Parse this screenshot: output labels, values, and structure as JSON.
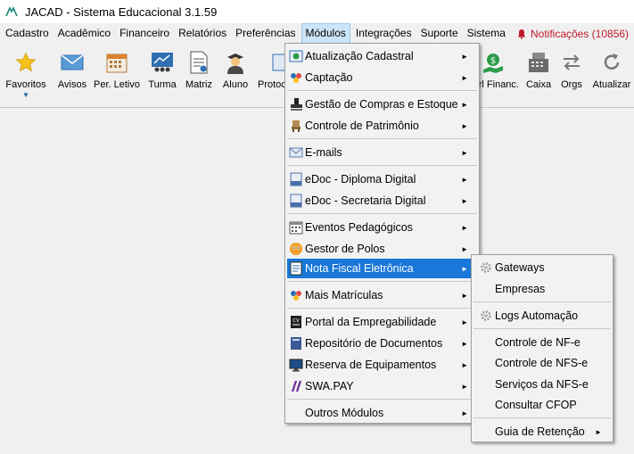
{
  "window": {
    "title": "JACAD - Sistema Educacional 3.1.59"
  },
  "menubar": {
    "items": [
      {
        "label": "Cadastro"
      },
      {
        "label": "Acadêmico"
      },
      {
        "label": "Financeiro"
      },
      {
        "label": "Relatórios"
      },
      {
        "label": "Preferências"
      },
      {
        "label": "Módulos"
      },
      {
        "label": "Integrações"
      },
      {
        "label": "Suporte"
      },
      {
        "label": "Sistema"
      }
    ],
    "notifications": "Notificações (10856)",
    "notification_color": "#c0182a"
  },
  "toolbar": {
    "items": [
      {
        "label": "Favoritos",
        "icon": "star-icon"
      },
      {
        "label": "Avisos",
        "icon": "envelope-icon"
      },
      {
        "label": "Per. Letivo",
        "icon": "calendar-icon"
      },
      {
        "label": "Turma",
        "icon": "class-icon"
      },
      {
        "label": "Matriz",
        "icon": "document-icon"
      },
      {
        "label": "Aluno",
        "icon": "student-icon"
      },
      {
        "label": "Protoc",
        "icon": "protocol-icon"
      },
      {
        "label": "rl Financ.",
        "icon": "money-icon"
      },
      {
        "label": "Caixa",
        "icon": "cash-register-icon"
      },
      {
        "label": "Orgs",
        "icon": "arrows-icon"
      },
      {
        "label": "Atualizar",
        "icon": "refresh-icon"
      }
    ]
  },
  "modulos_menu": {
    "items": [
      {
        "label": "Atualização Cadastral",
        "icon": "update-icon",
        "submenu": true
      },
      {
        "label": "Captação",
        "icon": "capture-icon",
        "submenu": true
      },
      {
        "label": "Gestão de Compras e Estoque",
        "icon": "stamp-icon",
        "submenu": true
      },
      {
        "label": "Controle de Patrimônio",
        "icon": "chair-icon",
        "submenu": true
      },
      {
        "label": "E-mails",
        "icon": "email-icon",
        "submenu": true
      },
      {
        "label": "eDoc - Diploma Digital",
        "icon": "edoc-icon",
        "submenu": true
      },
      {
        "label": "eDoc - Secretaria Digital",
        "icon": "edoc-icon",
        "submenu": true
      },
      {
        "label": "Eventos Pedagógicos",
        "icon": "events-icon",
        "submenu": true
      },
      {
        "label": "Gestor de Polos",
        "icon": "poles-icon",
        "submenu": true
      },
      {
        "label": "Nota Fiscal Eletrônica",
        "icon": "invoice-icon",
        "submenu": true
      },
      {
        "label": "Mais Matrículas",
        "icon": "enroll-icon",
        "submenu": true
      },
      {
        "label": "Portal da Empregabilidade",
        "icon": "cv-icon",
        "submenu": true
      },
      {
        "label": "Repositório de Documentos",
        "icon": "repository-icon",
        "submenu": true
      },
      {
        "label": "Reserva de Equipamentos",
        "icon": "monitor-icon",
        "submenu": true
      },
      {
        "label": "SWA.PAY",
        "icon": "swapay-icon",
        "submenu": true
      },
      {
        "label": "Outros Módulos",
        "icon": "",
        "submenu": true
      }
    ]
  },
  "nfe_menu": {
    "items": [
      {
        "label": "Gateways",
        "icon": "gear-icon",
        "submenu": false
      },
      {
        "label": "Empresas",
        "icon": "",
        "submenu": false
      },
      {
        "label": "Logs Automação",
        "icon": "gear-icon",
        "submenu": false
      },
      {
        "label": "Controle de NF-e",
        "icon": "",
        "submenu": false
      },
      {
        "label": "Controle de NFS-e",
        "icon": "",
        "submenu": false
      },
      {
        "label": "Serviços da NFS-e",
        "icon": "",
        "submenu": false
      },
      {
        "label": "Consultar CFOP",
        "icon": "",
        "submenu": false
      },
      {
        "label": "Guia de Retenção",
        "icon": "",
        "submenu": true
      }
    ]
  },
  "colors": {
    "highlight": "#1877d8",
    "menubar_active": "#cce4f7"
  }
}
